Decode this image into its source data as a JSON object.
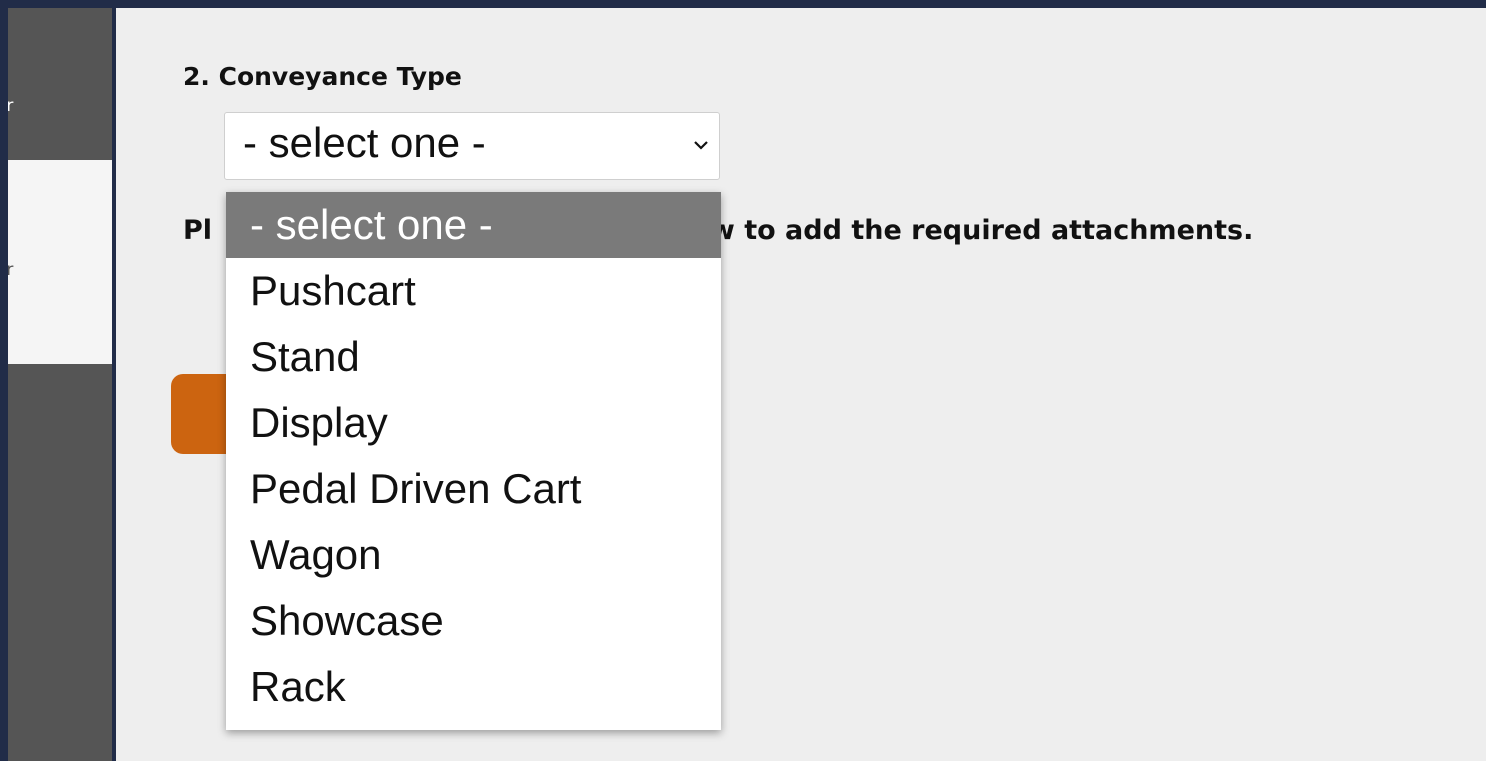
{
  "sidebar": {
    "items": [
      {
        "label": "or"
      },
      {
        "label": "or"
      }
    ]
  },
  "form": {
    "section_title": "2. Conveyance Type",
    "select": {
      "selected_value": "- select one -",
      "options": [
        "- select one -",
        "Pushcart",
        "Stand",
        "Display",
        "Pedal Driven Cart",
        "Wagon",
        "Showcase",
        "Rack"
      ]
    },
    "instruction_prefix": "Pl",
    "instruction_suffix": "low to add the required attachments."
  },
  "colors": {
    "frame": "#212c48",
    "sidebar": "#555555",
    "sidebar_active": "#f5f5f5",
    "content_bg": "#eeeeee",
    "accent_button": "#cc6410",
    "selected_option": "#7a7a7a"
  },
  "icons": {
    "select_chevron": "chevron-down-icon"
  }
}
